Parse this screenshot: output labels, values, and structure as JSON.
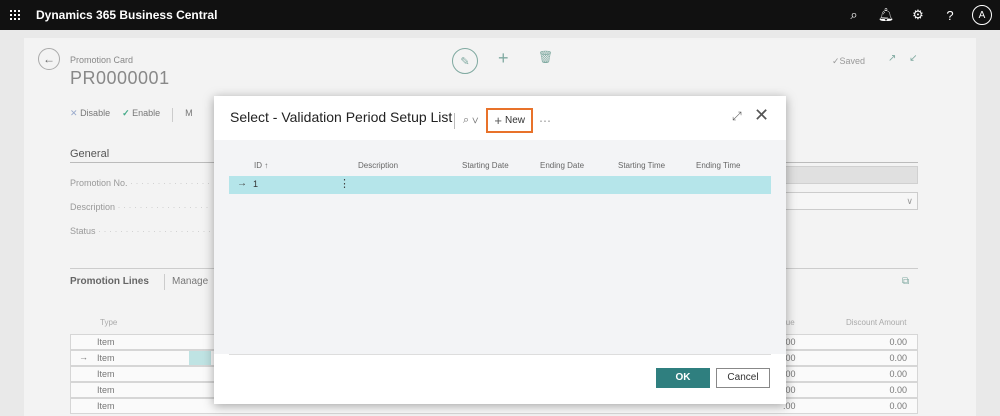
{
  "app": {
    "title": "Dynamics 365 Business Central",
    "avatar": "A"
  },
  "topbar_icons": [
    "search-icon",
    "bell-icon",
    "gear-icon",
    "help-icon"
  ],
  "card": {
    "breadcrumb": "Promotion Card",
    "record_no": "PR0000001",
    "status": "Saved",
    "actions": {
      "disable": "Disable",
      "enable": "Enable",
      "more": "M"
    },
    "general": "General",
    "fields": [
      "Promotion No.",
      "Description",
      "Status"
    ],
    "lines_title": "Promotion Lines",
    "lines_manage": "Manage",
    "line_columns": {
      "type": "Type",
      "value": "lue",
      "discount_amount": "Discount Amount"
    },
    "lines": [
      {
        "type": "Item",
        "value": ".00",
        "amount": "0.00"
      },
      {
        "type": "Item",
        "value": ".00",
        "amount": "0.00"
      },
      {
        "type": "Item",
        "value": ".00",
        "amount": "0.00"
      },
      {
        "type": "Item",
        "value": ".00",
        "amount": "0.00"
      },
      {
        "type": "Item",
        "value": ".00",
        "amount": "0.00"
      }
    ]
  },
  "modal": {
    "title": "Select - Validation Period Setup List",
    "new_label": "New",
    "columns": {
      "id": "ID ↑",
      "description": "Description",
      "starting_date": "Starting Date",
      "ending_date": "Ending Date",
      "starting_time": "Starting Time",
      "ending_time": "Ending Time"
    },
    "rows": [
      {
        "id": "1"
      }
    ],
    "ok": "OK",
    "cancel": "Cancel"
  },
  "colors": {
    "accent": "#2f7f7f",
    "highlight": "#e8722a",
    "selected_row": "#b5e5ea",
    "topbar": "#111111"
  }
}
